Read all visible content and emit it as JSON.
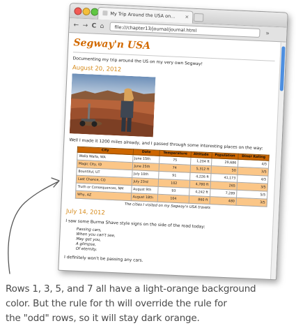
{
  "browser": {
    "tab_title": "My Trip Around the USA on...",
    "tab_close": "×",
    "url": "file:///chapter13/journal/journal.html",
    "nav": {
      "back": "←",
      "forward": "→",
      "reload": "C",
      "home": "⌂"
    },
    "menu": "»"
  },
  "page": {
    "heading": "Segway'n USA",
    "intro": "Documenting my trip around the US on my very own Segway!",
    "entries": [
      {
        "date": "August 20, 2012",
        "text": "Well I made it 1200 miles already, and I passed through some interesting places on the way:"
      },
      {
        "date": "July 14, 2012",
        "text": "I saw some Burma Shave style signs on the side of the road today:",
        "poem": [
          "Passing cars,",
          "When you can't see,",
          "May get you,",
          "A glimpse,",
          "Of eternity."
        ],
        "closing": "I definitely won't be passing any cars."
      }
    ]
  },
  "table": {
    "headers": [
      "City",
      "Date",
      "Temperature",
      "Altitude",
      "Population",
      "Diner Rating"
    ],
    "rows": [
      [
        "Walla Walla, WA",
        "June 15th",
        "75",
        "1,204 ft",
        "29,686",
        "4/5"
      ],
      [
        "Magic City, ID",
        "June 25th",
        "74",
        "5,312 ft",
        "50",
        "3/5"
      ],
      [
        "Bountiful, UT",
        "July 10th",
        "91",
        "4,226 ft",
        "41,173",
        "4/5"
      ],
      [
        "Last Chance, CO",
        "July 23rd",
        "102",
        "4,780 ft",
        "265",
        "3/5"
      ],
      [
        "Truth or Consequences, NM",
        "August 9th",
        "93",
        "4,242 ft",
        "7,289",
        "5/5"
      ],
      [
        "Why, AZ",
        "August 18th",
        "104",
        "860 ft",
        "480",
        "3/5"
      ]
    ],
    "caption": "The cities I visited on my Segway'n USA travels"
  },
  "annotation": {
    "line1": "Rows 1, 3, 5, and 7 all have a light-orange background",
    "line2": "color. But the rule for th will override the rule for",
    "line3": "the \"odd\" rows, so it will stay dark orange."
  },
  "colors": {
    "heading": "#d26a00",
    "date": "#d68a1a",
    "th_background": "#cc6600",
    "odd_row": "#fbc687"
  }
}
